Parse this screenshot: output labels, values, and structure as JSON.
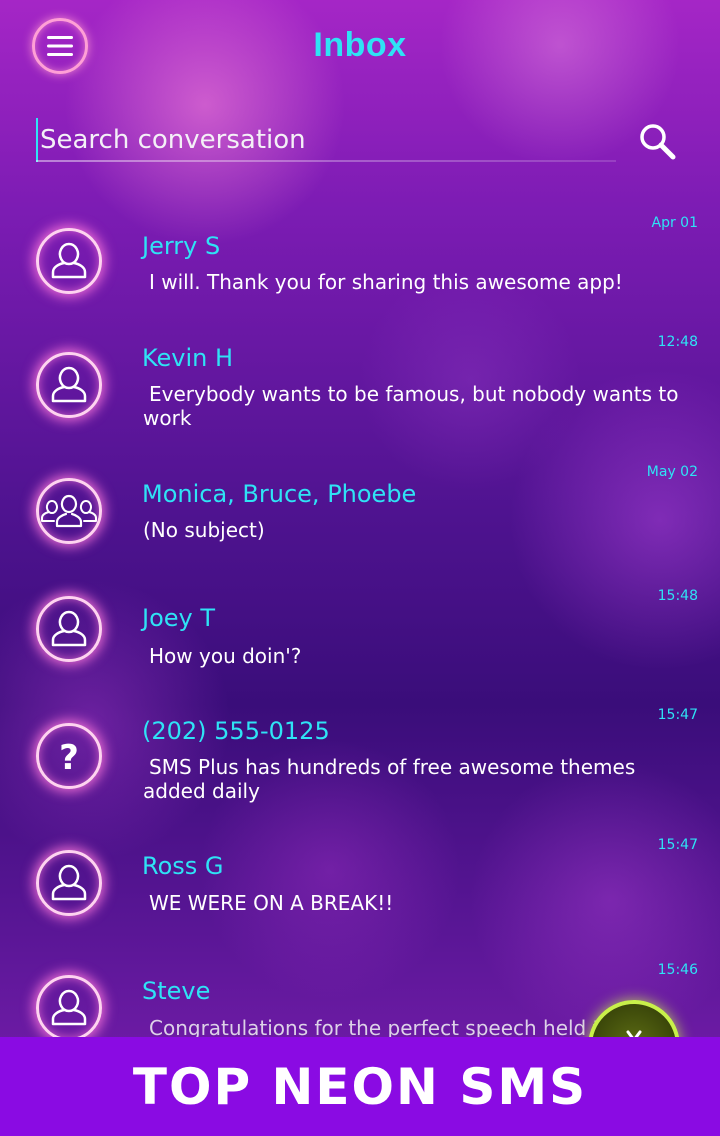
{
  "header": {
    "title": "Inbox",
    "menu_icon": "hamburger-menu-icon"
  },
  "search": {
    "placeholder": "Search conversation",
    "icon": "search-icon"
  },
  "conversations": [
    {
      "name": "Jerry S",
      "snippet": "I will. Thank you for sharing this awesome app!",
      "time": "Apr 01",
      "avatar": "person-icon"
    },
    {
      "name": "Kevin H",
      "snippet": "Everybody wants to be famous, but nobody wants to work",
      "time": "12:48",
      "avatar": "person-icon"
    },
    {
      "name": "Monica, Bruce, Phoebe",
      "snippet": "(No subject)",
      "time": "May 02",
      "avatar": "group-icon"
    },
    {
      "name": "Joey T",
      "snippet": "How you doin'?",
      "time": "15:48",
      "avatar": "person-icon"
    },
    {
      "name": "(202) 555-0125",
      "snippet": "SMS Plus has hundreds of free awesome themes added daily",
      "time": "15:47",
      "avatar": "question-mark-icon"
    },
    {
      "name": "Ross G",
      "snippet": "WE WERE ON A BREAK!!",
      "time": "15:47",
      "avatar": "person-icon"
    },
    {
      "name": "Steve",
      "snippet": "Congratulations for the perfect speech held today",
      "time": "15:46",
      "avatar": "person-icon"
    }
  ],
  "fab": {
    "icon": "compose-icon"
  },
  "banner": {
    "text": "TOP NEON SMS"
  },
  "colors": {
    "accent": "#2fe3f5",
    "banner": "#8a0be3",
    "fab_ring": "#c8f04a",
    "avatar_glow": "#ff78dc"
  }
}
